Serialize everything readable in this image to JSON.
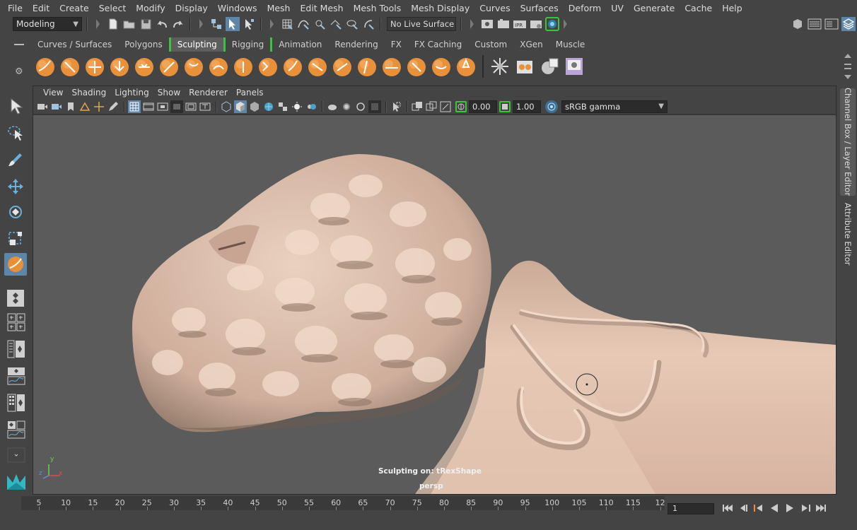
{
  "menubar": {
    "items": [
      "File",
      "Edit",
      "Create",
      "Select",
      "Modify",
      "Display",
      "Windows",
      "Mesh",
      "Edit Mesh",
      "Mesh Tools",
      "Mesh Display",
      "Curves",
      "Surfaces",
      "Deform",
      "UV",
      "Generate",
      "Cache",
      "Help"
    ]
  },
  "statusline": {
    "mode": "Modeling",
    "live_surface": "No Live Surface",
    "icons": [
      "new-scene-icon",
      "open-scene-icon",
      "save-scene-icon",
      "undo-icon",
      "redo-icon",
      "select-hierarchy-icon",
      "select-object-icon",
      "select-component-icon",
      "snap-grid-icon",
      "snap-curve-icon",
      "snap-point-icon",
      "snap-view-icon",
      "snap-surface-icon",
      "make-live-icon",
      "render-view-icon",
      "render-icon",
      "ipr-icon",
      "render-settings-icon",
      "hypershade-icon"
    ]
  },
  "shelf": {
    "tabs": [
      "Curves / Surfaces",
      "Polygons",
      "Sculpting",
      "Rigging",
      "Animation",
      "Rendering",
      "FX",
      "FX Caching",
      "Custom",
      "XGen",
      "Muscle"
    ],
    "active_tab": "Sculpting",
    "brush_icons": [
      "sculpt-icon",
      "smooth-icon",
      "relax-icon",
      "grab-icon",
      "pinch-icon",
      "flatten-icon",
      "foamy-icon",
      "spray-icon",
      "repeat-icon",
      "imprint-icon",
      "wax-icon",
      "scrape-icon",
      "fill-icon",
      "knife-icon",
      "smear-icon",
      "bulge-icon",
      "amplify-icon",
      "freeze-icon",
      "convert-to-frozen-icon",
      "unfreeze-icon",
      "sculpt-mesh-icon",
      "blend-shape-icon"
    ]
  },
  "toolbox": {
    "tools": [
      "select-tool-icon",
      "lasso-tool-icon",
      "paint-select-tool-icon",
      "move-tool-icon",
      "rotate-tool-icon",
      "scale-tool-icon",
      "sculpt-tool-icon"
    ],
    "active_tool": "sculpt-tool-icon"
  },
  "viewport": {
    "menu": [
      "View",
      "Shading",
      "Lighting",
      "Show",
      "Renderer",
      "Panels"
    ],
    "exposure": "0.00",
    "gamma": "1.00",
    "color_space": "sRGB gamma",
    "hud_message": "Sculpting on: tRexShape",
    "camera_label": "persp",
    "axis_labels": {
      "y": "y",
      "z": "z",
      "x": "x"
    },
    "background_color": "#5b5b5b",
    "mesh_color": "#d9b8a6"
  },
  "side_panel": {
    "tabs": [
      "Channel Box / Layer Editor",
      "Attribute Editor"
    ]
  },
  "timeslider": {
    "ticks": [
      "5",
      "10",
      "15",
      "20",
      "25",
      "30",
      "35",
      "40",
      "45",
      "50",
      "55",
      "60",
      "65",
      "70",
      "75",
      "80",
      "85",
      "90",
      "95",
      "100",
      "105",
      "110",
      "115",
      "12"
    ],
    "current_frame": "1"
  },
  "colors": {
    "ui_bg": "#444444",
    "accent_green": "#3ec23e",
    "brush_orange": "#e8913a",
    "active_blue": "#5e86a8"
  }
}
